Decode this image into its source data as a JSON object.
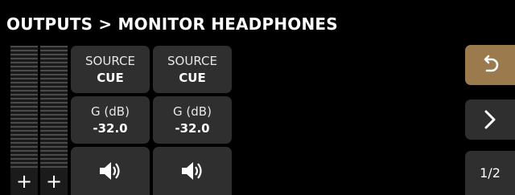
{
  "header": {
    "title": "OUTPUTS > MONITOR HEADPHONES"
  },
  "meters": [
    {
      "plus_label": "+"
    },
    {
      "plus_label": "+"
    }
  ],
  "channels": [
    {
      "source": {
        "label": "SOURCE",
        "value": "CUE"
      },
      "gain": {
        "label": "G (dB)",
        "value": "-32.0"
      },
      "speaker_icon": "speaker-icon"
    },
    {
      "source": {
        "label": "SOURCE",
        "value": "CUE"
      },
      "gain": {
        "label": "G (dB)",
        "value": "-32.0"
      },
      "speaker_icon": "speaker-icon"
    }
  ],
  "sidebar": {
    "back_icon": "undo-arrow-icon",
    "next_icon": "chevron-right-icon",
    "page_label": "1/2",
    "back_color": "#9b7b4d"
  }
}
